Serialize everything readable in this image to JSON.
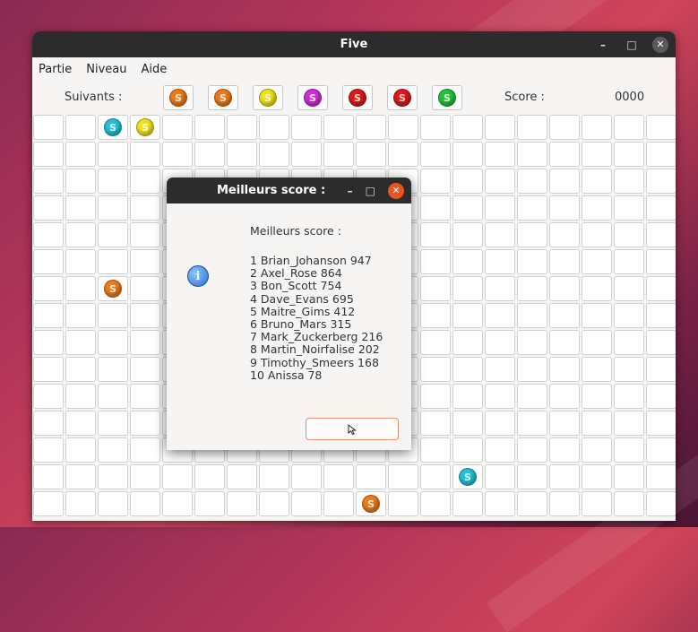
{
  "window": {
    "title": "Five",
    "controls": {
      "minimize": "–",
      "maximize": "□",
      "close": "✕"
    }
  },
  "menu": [
    "Partie",
    "Niveau",
    "Aide"
  ],
  "next": {
    "label": "Suivants :",
    "balls": [
      "orange",
      "orange",
      "yellow",
      "magenta",
      "red",
      "red",
      "green"
    ]
  },
  "score": {
    "label": "Score :",
    "value": "0000"
  },
  "board": {
    "columns": 20,
    "rows": 15,
    "balls": [
      {
        "row": 0,
        "col": 2,
        "color": "cyan"
      },
      {
        "row": 0,
        "col": 3,
        "color": "yellow"
      },
      {
        "row": 6,
        "col": 2,
        "color": "orange"
      },
      {
        "row": 13,
        "col": 13,
        "color": "cyan"
      },
      {
        "row": 14,
        "col": 10,
        "color": "orange"
      }
    ]
  },
  "colors": {
    "orange": "#f07a1a",
    "yellow": "#f2e21a",
    "magenta": "#d12bd6",
    "red": "#e01818",
    "green": "#22c43a",
    "cyan": "#22c3d8",
    "accent": "#e95420"
  },
  "dialog": {
    "title": "Meilleurs score :",
    "header": "Meilleurs score :",
    "icon": "info-icon",
    "scores": [
      "1 Brian_Johanson 947",
      "2 Axel_Rose 864",
      "3 Bon_Scott 754",
      "4 Dave_Evans 695",
      "5 Maitre_Gims 412",
      "6 Bruno_Mars 315",
      "7 Mark_Zuckerberg 216",
      "8 Martin_Noirfalise 202",
      "9 Timothy_Smeers 168",
      "10 Anissa 78"
    ],
    "button_label": ""
  }
}
